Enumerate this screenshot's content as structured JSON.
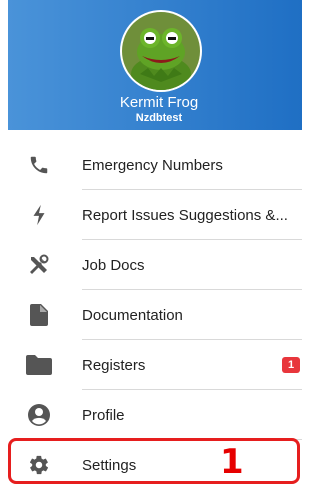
{
  "profile": {
    "name": "Kermit Frog",
    "subtitle": "Nzdbtest",
    "avatar_icon": "frog-avatar"
  },
  "menu": [
    {
      "label": "Emergency Numbers",
      "icon": "phone-icon"
    },
    {
      "label": "Report Issues Suggestions &...",
      "icon": "bolt-icon"
    },
    {
      "label": "Job Docs",
      "icon": "tools-icon"
    },
    {
      "label": "Documentation",
      "icon": "document-icon"
    },
    {
      "label": "Registers",
      "icon": "folder-icon",
      "badge": "1"
    },
    {
      "label": "Profile",
      "icon": "user-circle-icon"
    },
    {
      "label": "Settings",
      "icon": "gear-icon"
    }
  ],
  "annotation": {
    "number": "1",
    "color": "#e60000"
  },
  "colors": {
    "header": "#1f6fc4",
    "badge": "#e8363c",
    "icon": "#555555"
  }
}
